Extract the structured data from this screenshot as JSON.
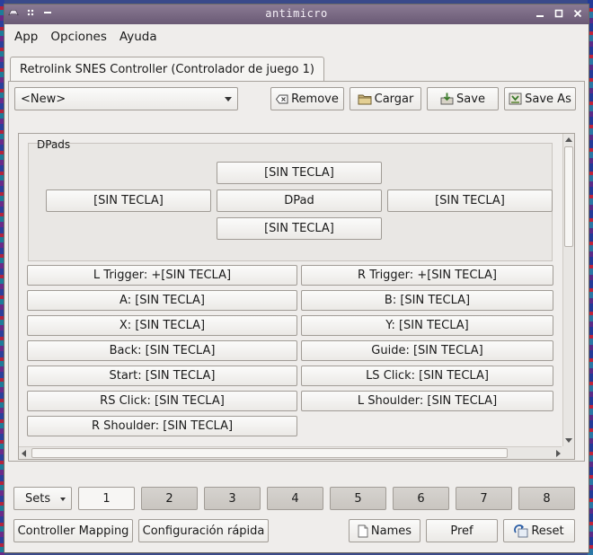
{
  "window": {
    "title": "antimicro"
  },
  "menu": {
    "app": "App",
    "opciones": "Opciones",
    "ayuda": "Ayuda"
  },
  "tab": {
    "label": "Retrolink SNES Controller (Controlador de juego 1)"
  },
  "profile": {
    "selected": "<New>",
    "remove": "Remove",
    "cargar": "Cargar",
    "save": "Save",
    "save_as": "Save As"
  },
  "dpad": {
    "title": "DPads",
    "up": "[SIN TECLA]",
    "left": "[SIN TECLA]",
    "center": "DPad",
    "right": "[SIN TECLA]",
    "down": "[SIN TECLA]"
  },
  "buttons": [
    "L Trigger: +[SIN TECLA]",
    "R Trigger: +[SIN TECLA]",
    "A: [SIN TECLA]",
    "B: [SIN TECLA]",
    "X: [SIN TECLA]",
    "Y: [SIN TECLA]",
    "Back: [SIN TECLA]",
    "Guide: [SIN TECLA]",
    "Start: [SIN TECLA]",
    "LS Click: [SIN TECLA]",
    "RS Click: [SIN TECLA]",
    "L Shoulder: [SIN TECLA]",
    "R Shoulder: [SIN TECLA]"
  ],
  "sets": {
    "label": "Sets",
    "numbers": [
      "1",
      "2",
      "3",
      "4",
      "5",
      "6",
      "7",
      "8"
    ],
    "active": "1"
  },
  "bottom": {
    "controller_mapping": "Controller Mapping",
    "configuracion_rapida": "Configuración rápida",
    "names": "Names",
    "pref": "Pref",
    "reset": "Reset"
  },
  "icons": [
    "app-gamepad-icon",
    "pin-icon",
    "minimize-icon",
    "restore-icon",
    "close-icon",
    "remove-icon",
    "folder-icon",
    "save-icon",
    "save-as-icon",
    "names-icon",
    "reset-icon"
  ]
}
